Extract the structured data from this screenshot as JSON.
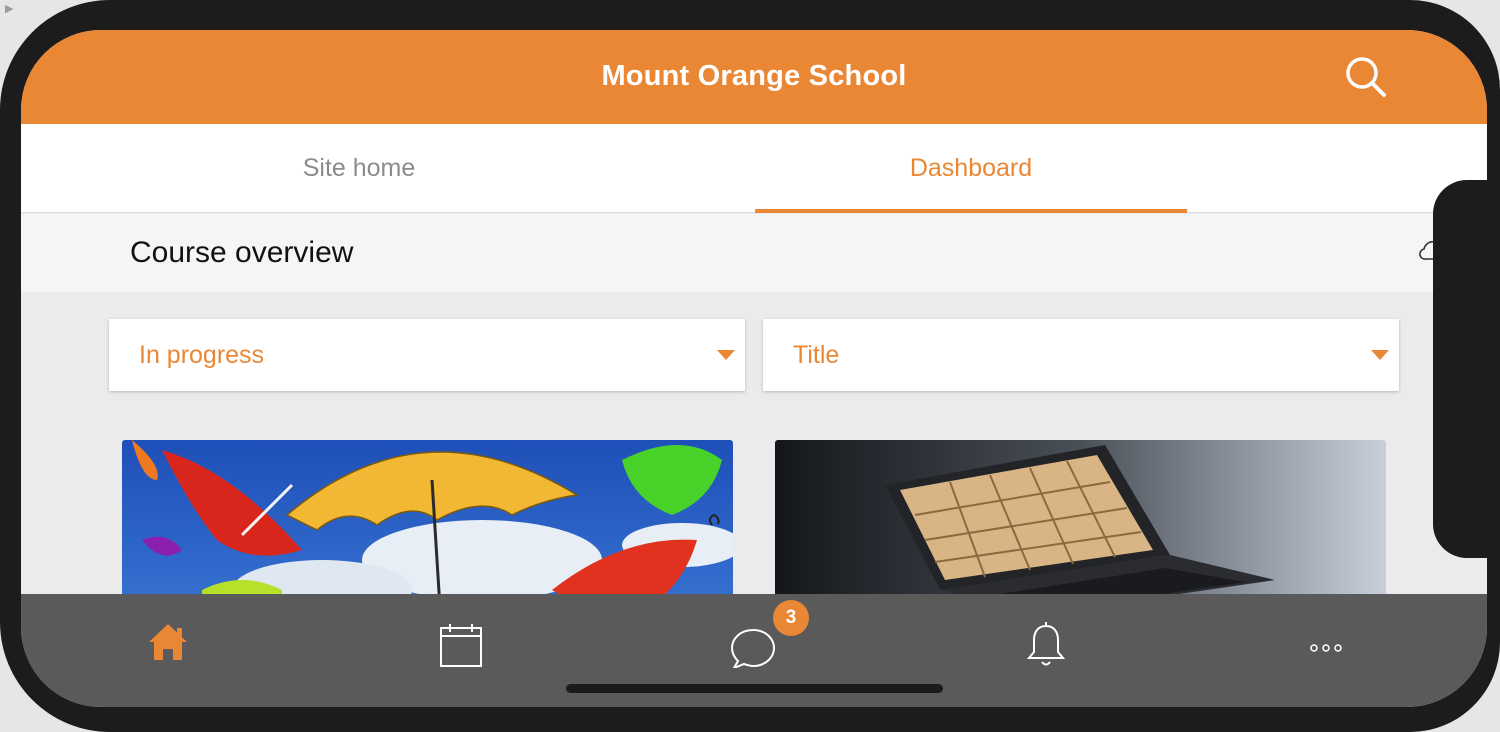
{
  "app": {
    "title": "Mount Orange School",
    "accent_color": "#ea8735",
    "header_bg": "#ea8735",
    "bottom_bar_bg": "#5a5a5a",
    "window_control_icon": "play-icon"
  },
  "header": {
    "search_icon": "search-icon"
  },
  "tabs": [
    {
      "label": "Site home",
      "active": false
    },
    {
      "label": "Dashboard",
      "active": true
    }
  ],
  "section": {
    "title": "Course overview",
    "icon": "cloud-icon"
  },
  "filters": {
    "status": {
      "selected": "In progress"
    },
    "sort": {
      "selected": "Title"
    }
  },
  "courses": [
    {
      "image": "umbrellas-image"
    },
    {
      "image": "laptop-bookshelf-image"
    }
  ],
  "bottom_nav": {
    "items": [
      {
        "icon": "home-icon",
        "active": true
      },
      {
        "icon": "calendar-icon",
        "active": false
      },
      {
        "icon": "messages-icon",
        "active": false,
        "badge": "3"
      },
      {
        "icon": "bell-icon",
        "active": false
      },
      {
        "icon": "more-icon",
        "active": false
      }
    ]
  }
}
